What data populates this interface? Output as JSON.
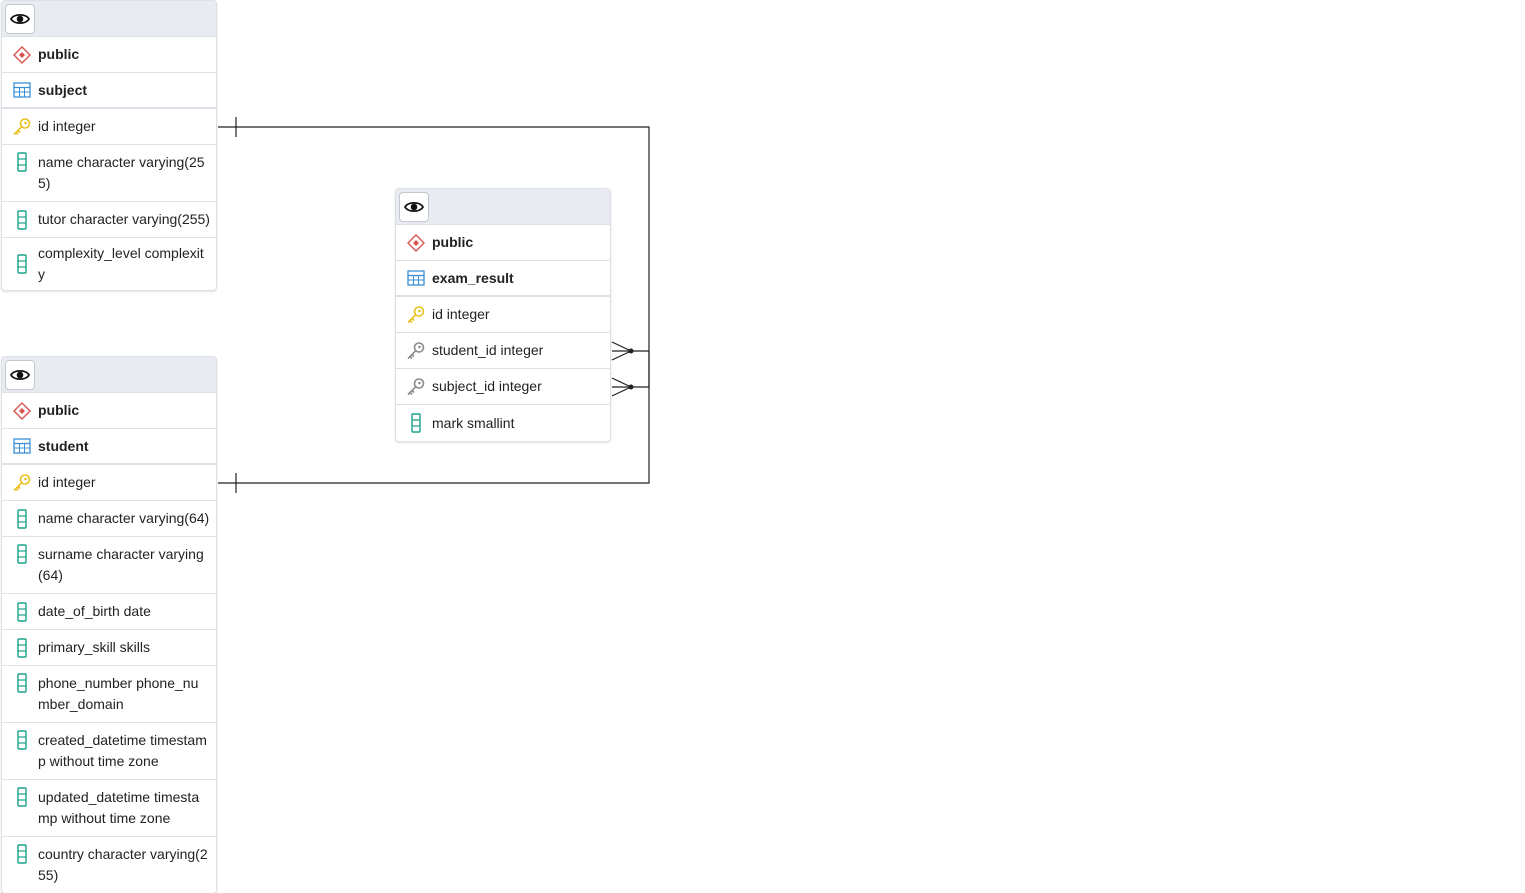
{
  "tables": {
    "subject": {
      "schema": "public",
      "name": "subject",
      "columns": [
        {
          "text": "id integer",
          "icon": "primary-key-icon"
        },
        {
          "text": "name character varying(255)",
          "icon": "column-icon"
        },
        {
          "text": "tutor character varying(255)",
          "icon": "column-icon"
        },
        {
          "text": "complexity_level complexity",
          "icon": "column-icon"
        }
      ]
    },
    "exam_result": {
      "schema": "public",
      "name": "exam_result",
      "columns": [
        {
          "text": "id integer",
          "icon": "primary-key-icon"
        },
        {
          "text": "student_id integer",
          "icon": "foreign-key-icon"
        },
        {
          "text": "subject_id integer",
          "icon": "foreign-key-icon"
        },
        {
          "text": "mark smallint",
          "icon": "column-icon"
        }
      ]
    },
    "student": {
      "schema": "public",
      "name": "student",
      "columns": [
        {
          "text": "id integer",
          "icon": "primary-key-icon"
        },
        {
          "text": "name character varying(64)",
          "icon": "column-icon"
        },
        {
          "text": "surname character varying(64)",
          "icon": "column-icon"
        },
        {
          "text": "date_of_birth date",
          "icon": "column-icon"
        },
        {
          "text": "primary_skill skills",
          "icon": "column-icon"
        },
        {
          "text": "phone_number phone_number_domain",
          "icon": "column-icon"
        },
        {
          "text": "created_datetime timestamp without time zone",
          "icon": "column-icon"
        },
        {
          "text": "updated_datetime timestamp without time zone",
          "icon": "column-icon"
        },
        {
          "text": "country character varying(255)",
          "icon": "column-icon"
        }
      ]
    }
  },
  "relationships": [
    {
      "from": "exam_result.subject_id",
      "to": "subject.id",
      "cardinality": "many-to-one"
    },
    {
      "from": "exam_result.student_id",
      "to": "student.id",
      "cardinality": "many-to-one"
    }
  ],
  "colors": {
    "schema_icon": "#d9534f",
    "table_icon": "#3a8fd6",
    "primary_key": "#e8c21c",
    "foreign_key": "#8a8a8a",
    "column_icon": "#1aa38a",
    "header_bg": "#e8ebf0",
    "link_line": "#222222"
  }
}
